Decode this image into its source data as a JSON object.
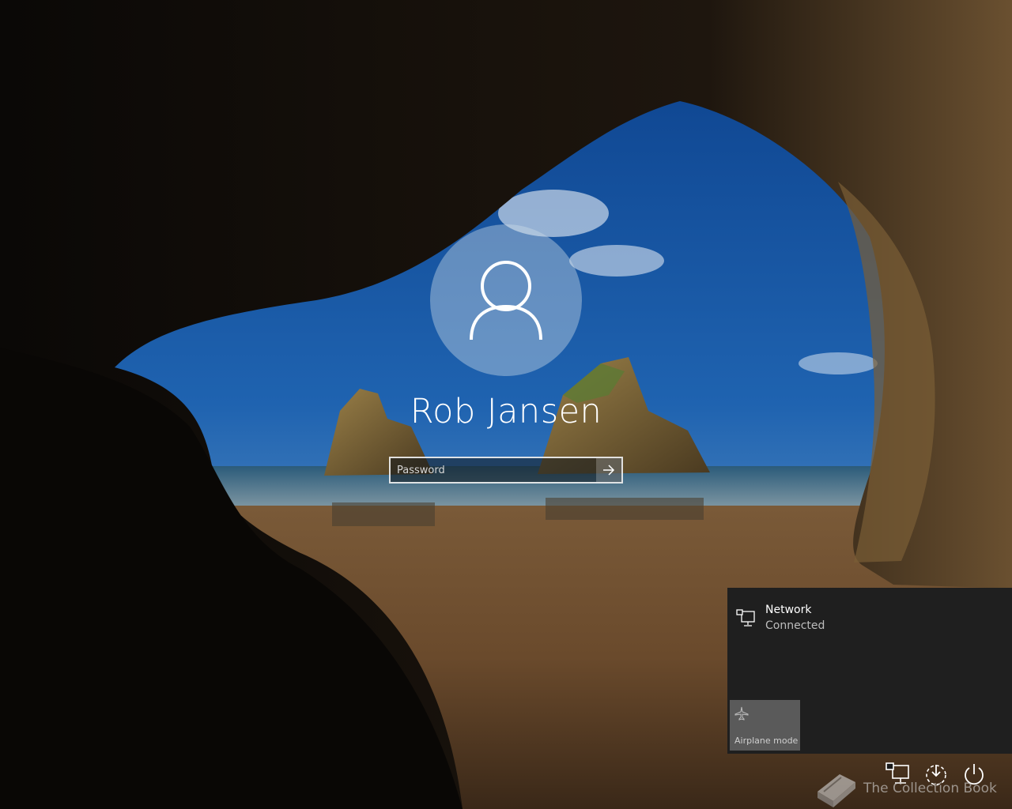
{
  "login": {
    "user_name": "Rob Jansen",
    "password_placeholder": "Password"
  },
  "network_flyout": {
    "network_name": "Network",
    "network_status": "Connected",
    "airplane_mode_label": "Airplane mode"
  },
  "watermark": {
    "text": "The Collection Book"
  },
  "icons": {
    "avatar": "user-silhouette-icon",
    "submit": "arrow-right-icon",
    "network": "wired-network-icon",
    "airplane": "airplane-icon",
    "tray": [
      "network-icon",
      "ease-of-access-icon",
      "power-icon"
    ]
  },
  "colors": {
    "flyout_bg": "#1f1f1f",
    "airplane_tile_bg": "#5a5a5a"
  }
}
